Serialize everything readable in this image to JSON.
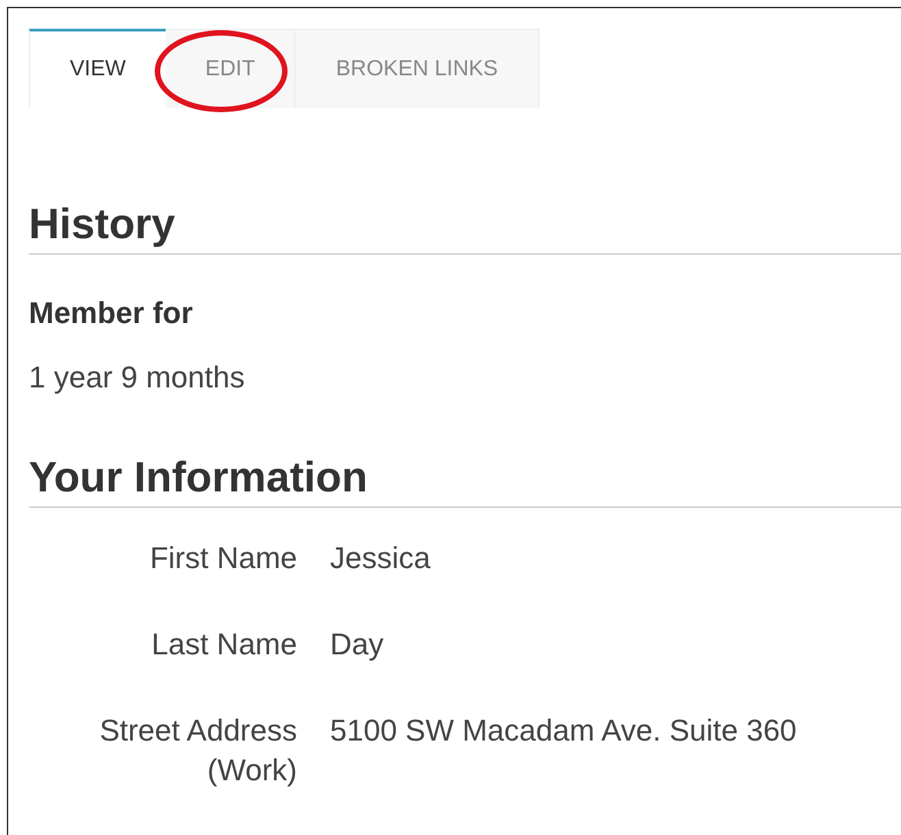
{
  "tabs": [
    {
      "label": "VIEW",
      "selected": true,
      "circled": false
    },
    {
      "label": "EDIT",
      "selected": false,
      "circled": true
    },
    {
      "label": "BROKEN LINKS",
      "selected": false,
      "circled": false
    }
  ],
  "history": {
    "heading": "History",
    "label": "Member for",
    "value": "1 year 9 months"
  },
  "info": {
    "heading": "Your Information",
    "fields": [
      {
        "label": "First Name",
        "value": "Jessica"
      },
      {
        "label": "Last Name",
        "value": "Day"
      },
      {
        "label": "Street Address (Work)",
        "value": "5100 SW Macadam Ave. Suite 360"
      }
    ]
  }
}
